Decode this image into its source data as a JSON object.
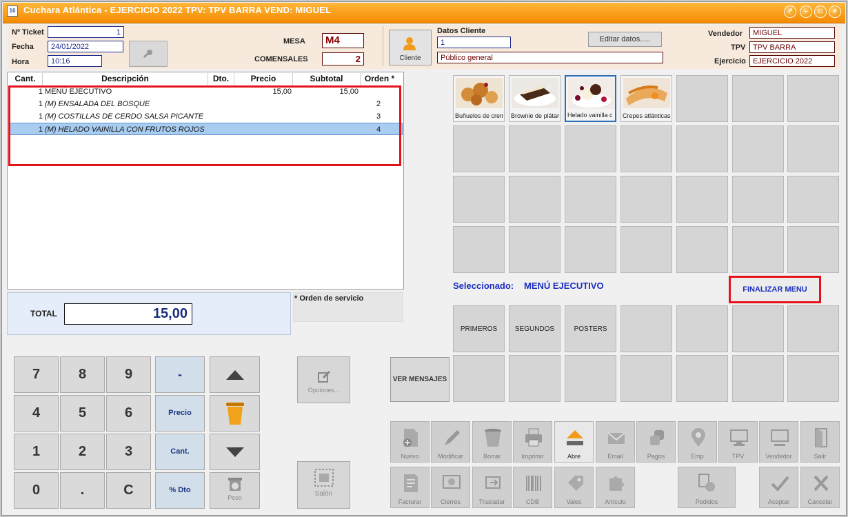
{
  "window": {
    "title": "Cuchara Atlántica - EJERCICIO 2022 TPV: TPV BARRA VEND: MIGUEL"
  },
  "header": {
    "ticket_label": "Nº Ticket",
    "ticket": "1",
    "fecha_label": "Fecha",
    "fecha": "24/01/2022",
    "hora_label": "Hora",
    "hora": "10:16",
    "mesa_label": "MESA",
    "mesa": "M4",
    "comensales_label": "COMENSALES",
    "comensales": "2",
    "cliente_button": "Cliente",
    "datos_cliente_label": "Datos Cliente",
    "cliente_codigo": "1",
    "cliente_nombre": "Público general",
    "editar_button": "Editar datos.....",
    "vendedor_label": "Vendedor",
    "vendedor": "MIGUEL",
    "tpv_label": "TPV",
    "tpv": "TPV BARRA",
    "ejercicio_label": "Ejercicio",
    "ejercicio": "EJERCICIO 2022"
  },
  "table": {
    "columns": [
      "Cant.",
      "Descripción",
      "Dto.",
      "Precio",
      "Subtotal",
      "Orden *"
    ],
    "rows": [
      {
        "cant": "1",
        "desc": "MENÚ EJECUTIVO",
        "precio": "15,00",
        "subtotal": "15,00",
        "orden": ""
      },
      {
        "cant": "1",
        "desc": "(M) ENSALADA DEL BOSQUE",
        "precio": "",
        "subtotal": "",
        "orden": "2"
      },
      {
        "cant": "1",
        "desc": "(M) COSTILLAS DE CERDO SALSA PICANTE",
        "precio": "",
        "subtotal": "",
        "orden": "3"
      },
      {
        "cant": "1",
        "desc": "(M) HELADO VAINILLA CON FRUTOS ROJOS",
        "precio": "",
        "subtotal": "",
        "orden": "4"
      }
    ]
  },
  "total": {
    "label": "TOTAL",
    "value": "15,00"
  },
  "orden_servicio": "* Orden de servicio",
  "keypad": {
    "keys": [
      "7",
      "8",
      "9",
      "4",
      "5",
      "6",
      "1",
      "2",
      "3",
      "0",
      ".",
      "C"
    ],
    "minus": "-",
    "precio": "Precio",
    "cant": "Cant.",
    "dto": "% Dto",
    "peso": "Peso"
  },
  "opciones": "Opciones...",
  "salon": "Salón",
  "ver_mensajes": "VER MENSAJES",
  "products": [
    {
      "label": "Buñuelos de crem",
      "icon": "bunuelos-image"
    },
    {
      "label": "Brownie de plátar",
      "icon": "brownie-image"
    },
    {
      "label": "Helado vainilla c",
      "icon": "helado-image"
    },
    {
      "label": "Crepes atlánticas",
      "icon": "crepes-image"
    }
  ],
  "seleccionado_label": "Seleccionado:",
  "seleccionado": "MENÚ EJECUTIVO",
  "finalizar_menu": "FINALIZAR MENU",
  "families": [
    "PRIMEROS",
    "SEGUNDOS",
    "POSTERS"
  ],
  "toolbar1": [
    "Nuevo",
    "Modificar",
    "Borrar",
    "Imprimir",
    "Abre",
    "Email",
    "Pagos",
    "Emp",
    "TPV",
    "Vendedor",
    "Salir"
  ],
  "toolbar2": [
    "Facturar",
    "Cierres",
    "Trasladar",
    "CDB",
    "Vales",
    "Artículo",
    "Pedidos",
    "Aceptar",
    "Cancelar"
  ],
  "colors": {
    "title_bar": "#f58a00",
    "accent_blue": "#1e2a8c",
    "highlight": "#e5121c"
  }
}
